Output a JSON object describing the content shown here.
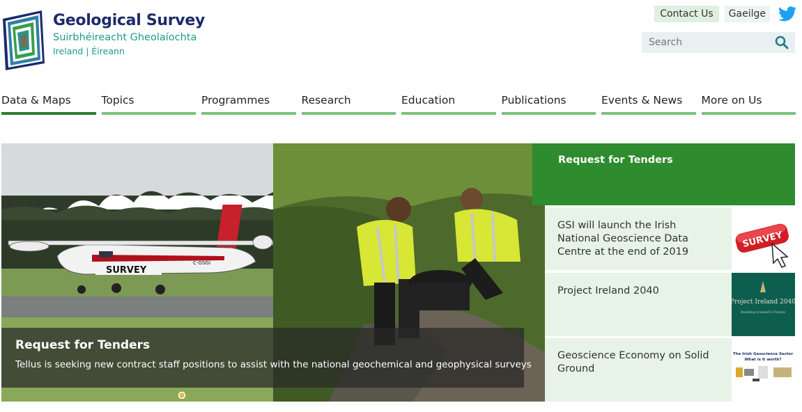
{
  "brand": {
    "title": "Geological Survey",
    "subtitle_irish": "Suirbhéireacht Gheolaíochta",
    "country": "Ireland | Éireann"
  },
  "top_links": {
    "contact": "Contact Us",
    "language": "Gaeilge"
  },
  "search": {
    "placeholder": "Search"
  },
  "nav": {
    "items": [
      "Data & Maps",
      "Topics",
      "Programmes",
      "Research",
      "Education",
      "Publications",
      "Events & News",
      "More on Us"
    ],
    "active": "Data & Maps"
  },
  "hero": {
    "plane_label": "SURVEY",
    "plane_reg": "C-GSGI",
    "caption_title": "Request for Tenders",
    "caption_text": "Tellus is seeking new contract staff positions to assist with the national geochemical and geophysical surveys"
  },
  "side": {
    "header": "Request for Tenders",
    "items": [
      {
        "text": "GSI will launch the Irish National Geoscience Data Centre at the end of 2019",
        "thumb_label": "SURVEY"
      },
      {
        "text": "Project Ireland 2040",
        "thumb_label": "Project Ireland 2040",
        "thumb_sub": "Building Ireland's Future"
      },
      {
        "text": "Geoscience Economy on Solid Ground",
        "thumb_label": "The Irish Geoscience Sector",
        "thumb_sub": "What is it worth?"
      }
    ]
  },
  "colors": {
    "brand_navy": "#1d2b6b",
    "brand_teal": "#1f9a8a",
    "nav_underline": "#7bc27e",
    "nav_active": "#2e7d32",
    "side_header": "#2e8b2e",
    "side_item_bg": "#e6f3e6",
    "twitter": "#1da1f2"
  },
  "icons": [
    "logo-mark",
    "twitter-icon",
    "search-icon"
  ]
}
